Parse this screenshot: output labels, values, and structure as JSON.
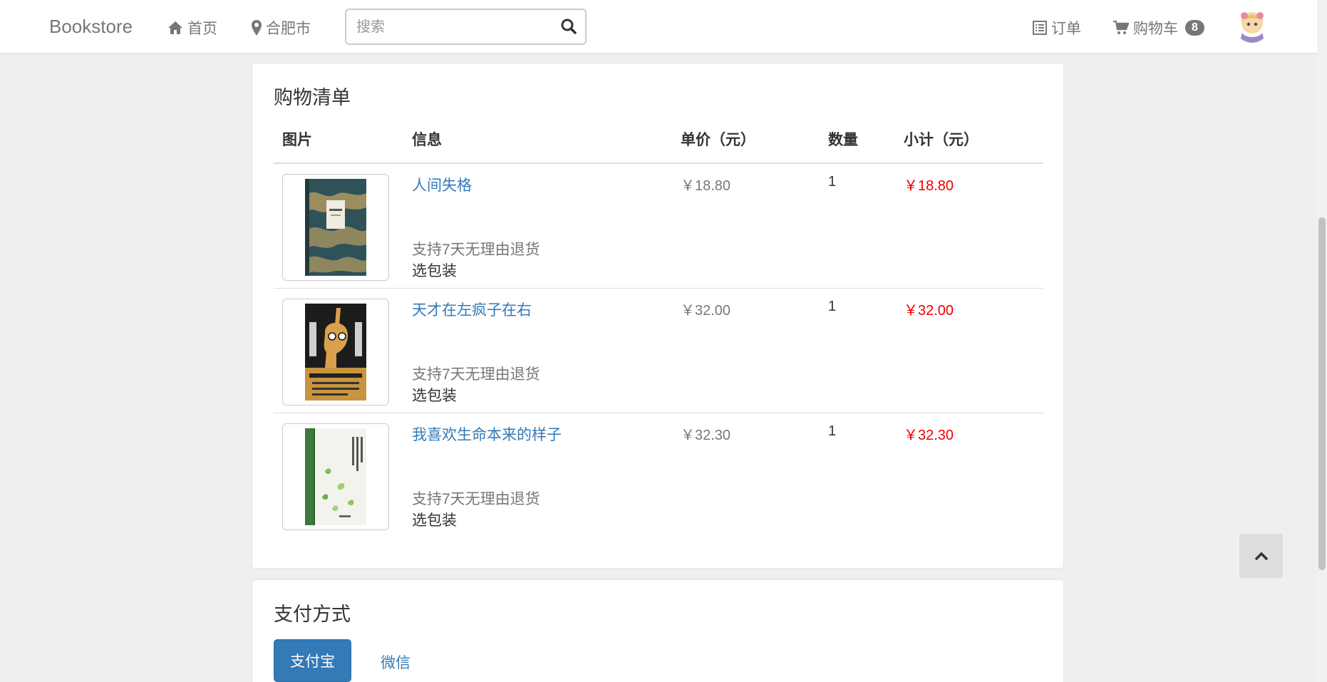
{
  "navbar": {
    "brand": "Bookstore",
    "home_label": "首页",
    "location_label": "合肥市",
    "search_placeholder": "搜索",
    "orders_label": "订单",
    "cart_label": "购物车",
    "cart_count": "8"
  },
  "cart": {
    "title": "购物清单",
    "columns": [
      "图片",
      "信息",
      "单价（元）",
      "数量",
      "小计（元）"
    ],
    "items": [
      {
        "title": "人间失格",
        "returns": "支持7天无理由退货",
        "packaging": "选包装",
        "price": "￥18.80",
        "quantity": "1",
        "subtotal": "￥18.80"
      },
      {
        "title": "天才在左疯子在右",
        "returns": "支持7天无理由退货",
        "packaging": "选包装",
        "price": "￥32.00",
        "quantity": "1",
        "subtotal": "￥32.00"
      },
      {
        "title": "我喜欢生命本来的样子",
        "returns": "支持7天无理由退货",
        "packaging": "选包装",
        "price": "￥32.30",
        "quantity": "1",
        "subtotal": "￥32.30"
      }
    ]
  },
  "payment": {
    "title": "支付方式",
    "options": [
      "支付宝",
      "微信"
    ]
  },
  "icons": {
    "home": "home-icon",
    "location": "map-marker-icon",
    "search": "search-icon",
    "orders": "list-icon",
    "cart": "shopping-cart-icon",
    "back_to_top": "chevron-up-icon"
  },
  "colors": {
    "link": "#337ab7",
    "subtotal": "#ee0000",
    "primary_button": "#337ab7"
  }
}
